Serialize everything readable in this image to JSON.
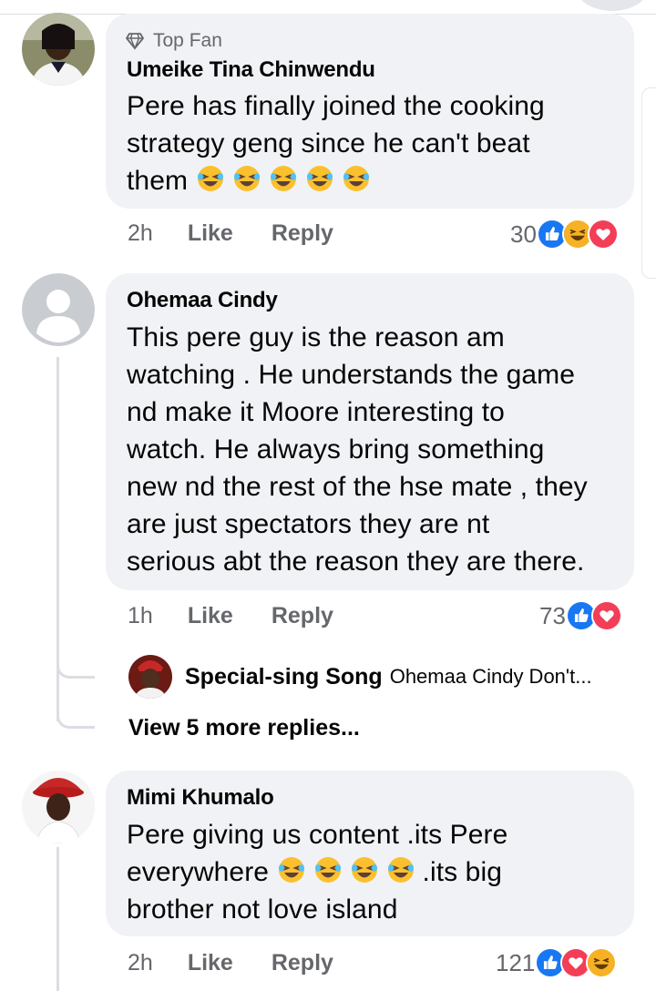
{
  "comments": [
    {
      "badge": "Top Fan",
      "author": "Umeike Tina Chinwendu",
      "text": "Pere has finally joined the cooking\nstrategy geng since he can't beat\nthem ",
      "time": "2h",
      "like_label": "Like",
      "reply_label": "Reply",
      "reaction_count": "30",
      "reactions": [
        "like-icon",
        "haha-icon",
        "love-icon"
      ]
    },
    {
      "author": "Ohemaa Cindy",
      "text": "This pere guy is the reason am\nwatching . He understands the game\nnd make it Moore interesting to\nwatch. He always bring something\nnew nd the rest of the hse mate , they\nare just spectators they are nt\nserious abt the reason they are there.",
      "time": "1h",
      "like_label": "Like",
      "reply_label": "Reply",
      "reaction_count": "73",
      "reactions": [
        "like-icon",
        "love-icon"
      ],
      "reply_preview": {
        "author": "Special-sing Song",
        "text": "Ohemaa Cindy Don't..."
      },
      "more_replies": "View 5 more replies..."
    },
    {
      "author": "Mimi Khumalo",
      "text_a": "Pere giving us content .its Pere\neverywhere ",
      "text_b": ".its  big\nbrother not love island",
      "time": "2h",
      "like_label": "Like",
      "reply_label": "Reply",
      "reaction_count": "121",
      "reactions": [
        "like-icon",
        "love-icon",
        "haha-icon"
      ]
    }
  ],
  "colors": {
    "bubble": "#f0f2f5",
    "secondary_text": "#65676b",
    "like_blue": "#1877f2",
    "love_red": "#f33e58",
    "haha_yellow": "#f7b125"
  }
}
